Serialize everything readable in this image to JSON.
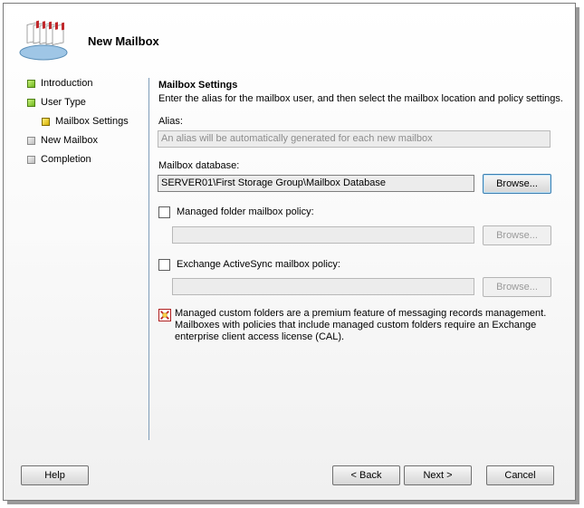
{
  "wizard": {
    "title": "New Mailbox"
  },
  "nav": {
    "items": [
      {
        "label": "Introduction",
        "state": "done"
      },
      {
        "label": "User Type",
        "state": "done"
      },
      {
        "label": "Mailbox Settings",
        "state": "current"
      },
      {
        "label": "New Mailbox",
        "state": "pending"
      },
      {
        "label": "Completion",
        "state": "pending"
      }
    ]
  },
  "page": {
    "title": "Mailbox Settings",
    "description": "Enter the alias for the mailbox user, and then select the mailbox location and policy settings.",
    "alias": {
      "label": "Alias:",
      "value": "An alias will be automatically generated for each new mailbox"
    },
    "database": {
      "label": "Mailbox database:",
      "value": "SERVER01\\First Storage Group\\Mailbox Database",
      "browse": "Browse..."
    },
    "managed_folder": {
      "label": "Managed folder mailbox policy:",
      "checked": false,
      "value": "",
      "browse": "Browse..."
    },
    "activesync": {
      "label": "Exchange ActiveSync mailbox policy:",
      "checked": false,
      "value": "",
      "browse": "Browse..."
    },
    "note": {
      "line1": "Managed custom folders are a premium feature of messaging records management.",
      "line2": "Mailboxes with policies that include managed custom folders require an Exchange",
      "line3": "enterprise client access license (CAL)."
    }
  },
  "buttons": {
    "help": "Help",
    "back": "< Back",
    "next": "Next >",
    "cancel": "Cancel"
  },
  "colors": {
    "done": "#6fb61e",
    "current": "#d6b000",
    "pending": "#bdbdbd",
    "divider": "#7f9db9"
  }
}
